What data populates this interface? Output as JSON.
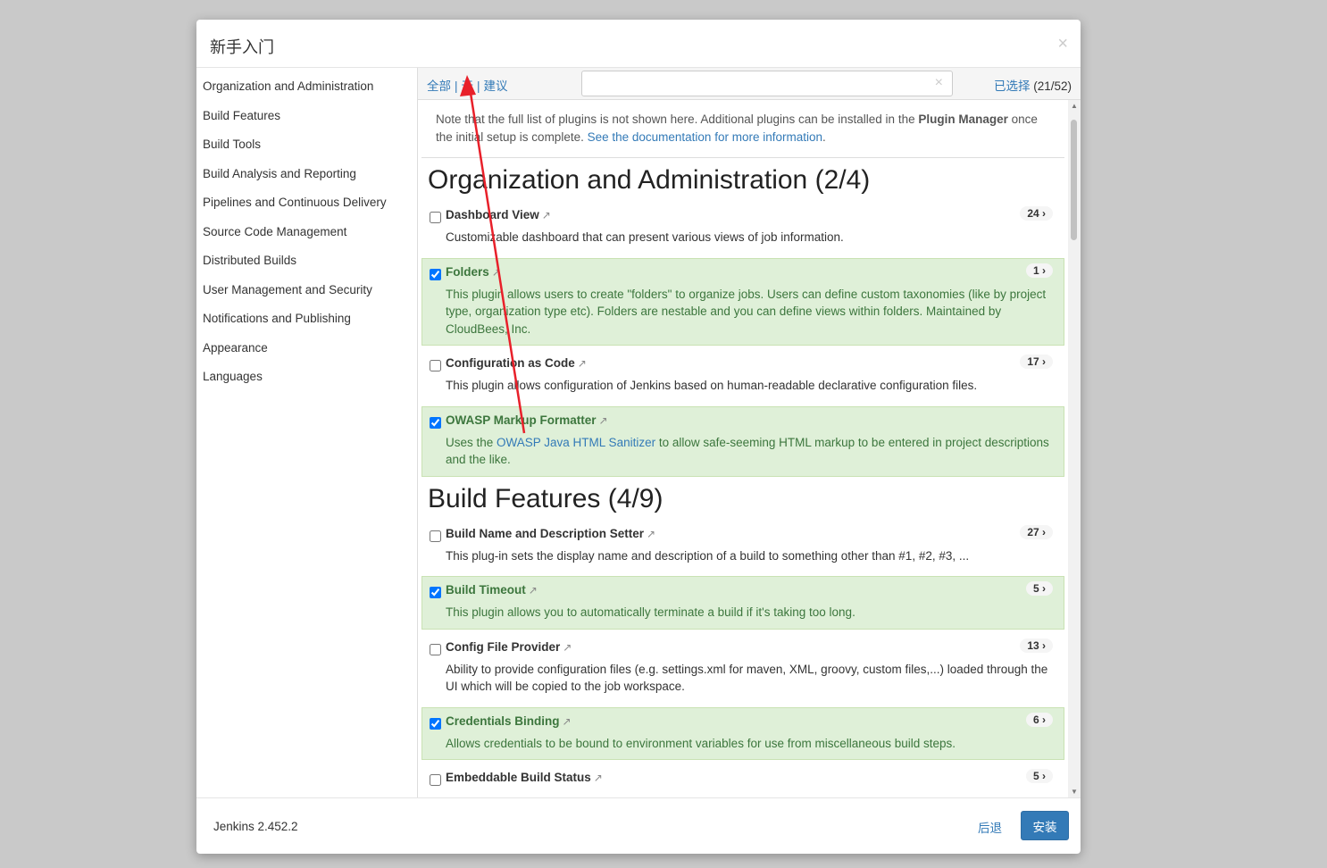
{
  "title": "新手入门",
  "sidebar": [
    "Organization and Administration",
    "Build Features",
    "Build Tools",
    "Build Analysis and Reporting",
    "Pipelines and Continuous Delivery",
    "Source Code Management",
    "Distributed Builds",
    "User Management and Security",
    "Notifications and Publishing",
    "Appearance",
    "Languages"
  ],
  "toolbar": {
    "all": "全部",
    "none": "无",
    "suggested": "建议",
    "sep": "|",
    "search_value": "",
    "clear": "×",
    "selected_label": "已选择",
    "selected_count": "(21/52)"
  },
  "note": {
    "text1": "Note that the full list of plugins is not shown here. Additional plugins can be installed in the ",
    "bold": "Plugin Manager",
    "text2": " once the initial setup is complete. ",
    "link": "See the documentation for more information",
    "end": "."
  },
  "sections": [
    {
      "title": "Organization and Administration (2/4)",
      "plugins": [
        {
          "name": "Dashboard View",
          "count": "24 ›",
          "checked": false,
          "desc": "Customizable dashboard that can present various views of job information."
        },
        {
          "name": "Folders",
          "count": "1 ›",
          "checked": true,
          "desc": "This plugin allows users to create \"folders\" to organize jobs. Users can define custom taxonomies (like by project type, organization type etc). Folders are nestable and you can define views within folders. Maintained by CloudBees, Inc."
        },
        {
          "name": "Configuration as Code",
          "count": "17 ›",
          "checked": false,
          "desc": "This plugin allows configuration of Jenkins based on human-readable declarative configuration files."
        },
        {
          "name": "OWASP Markup Formatter",
          "count": "",
          "checked": true,
          "desc_pre": "Uses the ",
          "desc_link": "OWASP Java HTML Sanitizer",
          "desc_post": " to allow safe-seeming HTML markup to be entered in project descriptions and the like."
        }
      ]
    },
    {
      "title": "Build Features (4/9)",
      "plugins": [
        {
          "name": "Build Name and Description Setter",
          "count": "27 ›",
          "checked": false,
          "desc": "This plug-in sets the display name and description of a build to something other than #1, #2, #3, ..."
        },
        {
          "name": "Build Timeout",
          "count": "5 ›",
          "checked": true,
          "desc": "This plugin allows you to automatically terminate a build if it's taking too long."
        },
        {
          "name": "Config File Provider",
          "count": "13 ›",
          "checked": false,
          "desc": "Ability to provide configuration files (e.g. settings.xml for maven, XML, groovy, custom files,...) loaded through the UI which will be copied to the job workspace."
        },
        {
          "name": "Credentials Binding",
          "count": "6 ›",
          "checked": true,
          "desc": "Allows credentials to be bound to environment variables for use from miscellaneous build steps."
        },
        {
          "name": "Embeddable Build Status",
          "count": "5 ›",
          "checked": false,
          "desc": ""
        }
      ]
    }
  ],
  "footer": {
    "version": "Jenkins 2.452.2",
    "back": "后退",
    "install": "安装"
  }
}
